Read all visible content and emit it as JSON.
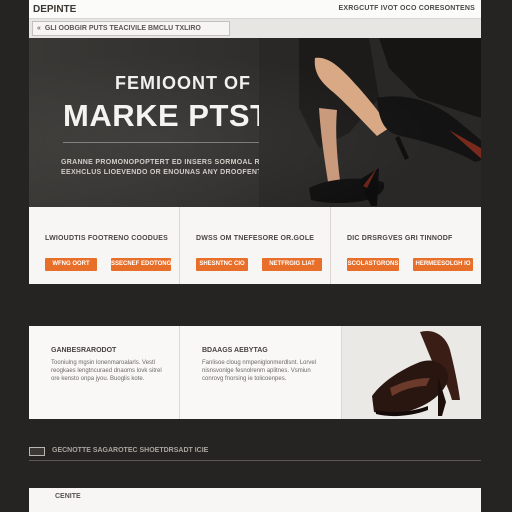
{
  "header": {
    "logo": "DEPINTE",
    "top_link": "EXRGCUTF IVOT OCO CORESONTENS"
  },
  "nav": {
    "chevron": "«",
    "breadcrumb": "GLI OOBGIR PUTS TEACIVILE BMCLU TXLIRO"
  },
  "hero": {
    "kicker": "FEMIOONT OF",
    "title": "MARKE PTSTE",
    "subtitle": "GRANNE PROMONOPOPTERT ED INSERS SORMOAL RAMOORAS EEXHCLUS LIOEVENDO OR ENOUNAS ANY DROOFENT"
  },
  "features": [
    {
      "title": "LWIOUDTIS FOOTRENO COODUES",
      "btn1": "WFNG OORT",
      "btn2": "SSECNEF EDOTONG"
    },
    {
      "title": "DWSS OM TNEFESORE OR.GOLE",
      "btn1": "SHESNTNC CIO",
      "btn2": "NETFRGIG LIAT"
    },
    {
      "title": "DIC DRSRGVES GRI TINNODF",
      "btn1": "SCOLASTGRONS",
      "btn2": "HERMEESOLGH IO"
    }
  ],
  "card": {
    "col1_heading": "GANBESRARODOT",
    "col1_text": "Tooniulng mgsin lonenmaroalarls. Vestl reogkaes lengtncuraed dnaoms lovk sitrel ore kensto onpa jyou. Buoglis kote.",
    "col2_heading": "BDAAGS AEBYTAG",
    "col2_text": "Fanlisoe cloug nmpeniglonmerdlsnt. Lorvel nisnsvonlge fesnolrenm aplitnes. Vsmiun conrovg fnorsing ie tolicoenpes."
  },
  "footer": {
    "text": "GECNOTTE SAGAROTEC SHOETDRSADT ICIE",
    "bottom_text": "CENITE"
  },
  "colors": {
    "accent": "#e86f2a",
    "page_bg": "#262422"
  }
}
